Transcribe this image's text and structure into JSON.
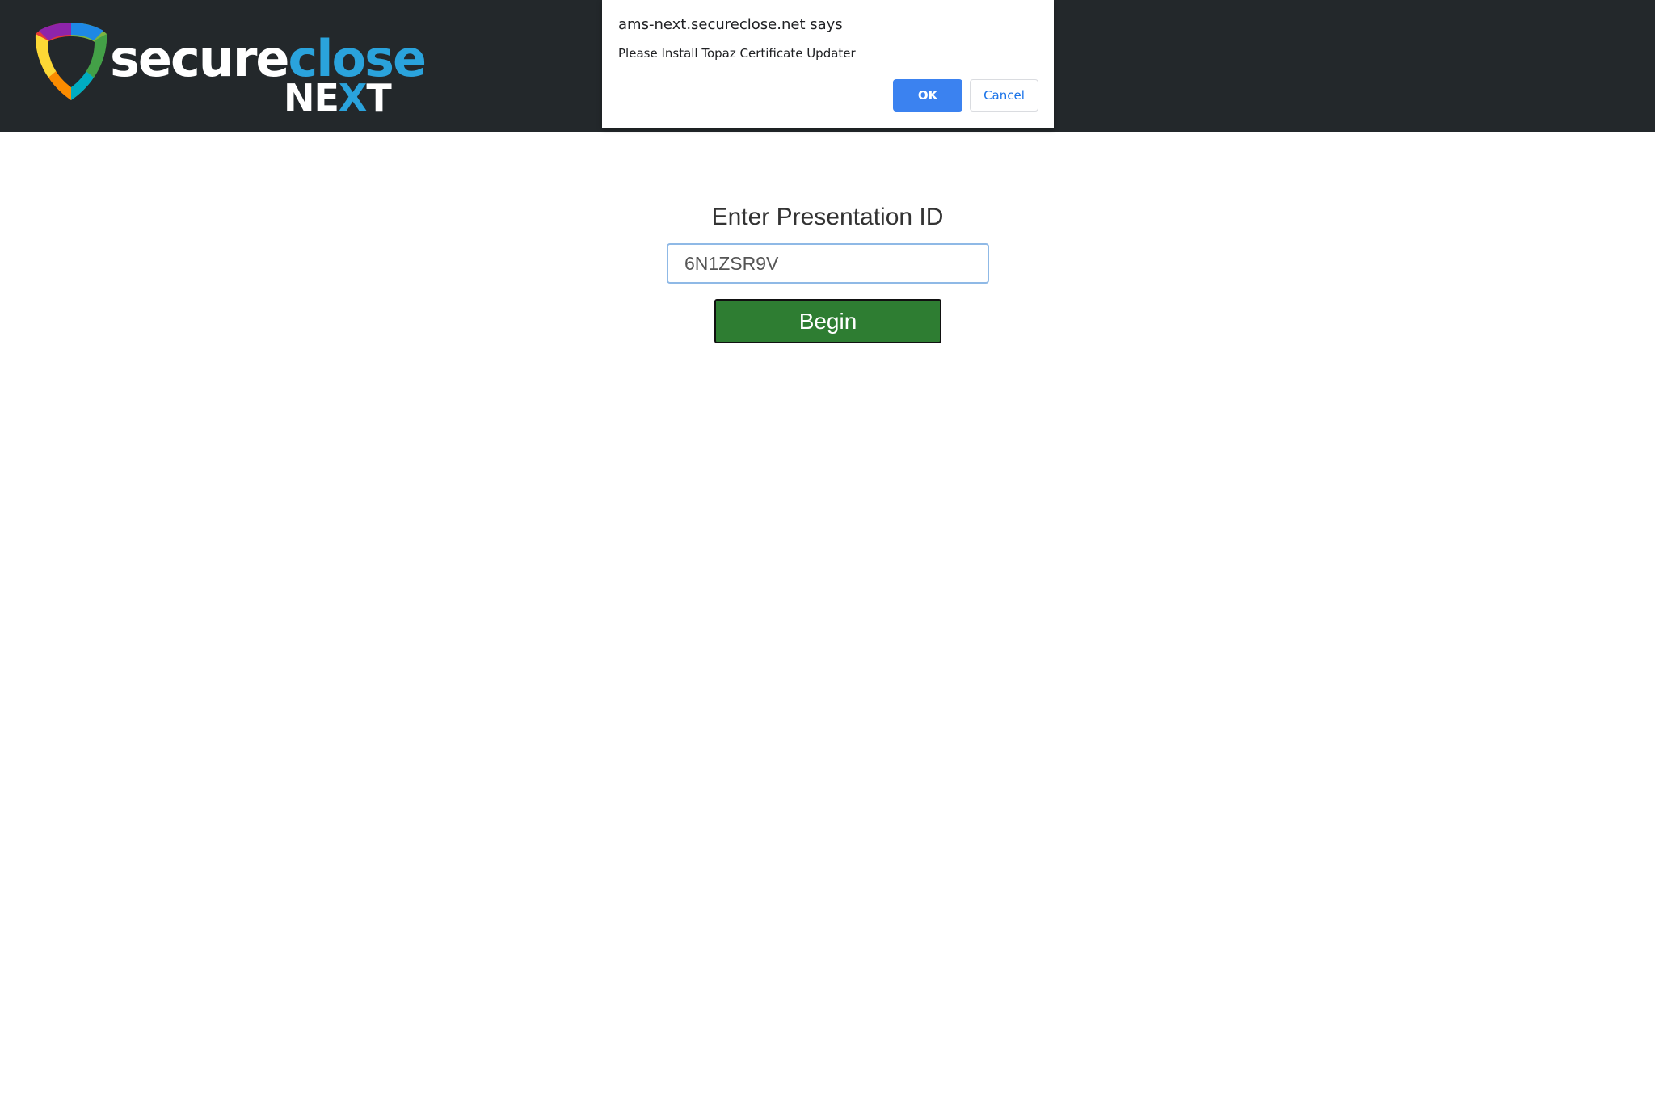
{
  "header": {
    "logo": {
      "icon": "shield-logo-icon",
      "word_secure": "secure",
      "word_close": "close",
      "word_next_1": "NE",
      "word_next_2": "X",
      "word_next_3": "T"
    }
  },
  "dialog": {
    "title": "ams-next.secureclose.net says",
    "message": "Please Install Topaz Certificate Updater",
    "ok_label": "OK",
    "cancel_label": "Cancel"
  },
  "form": {
    "heading": "Enter Presentation ID",
    "presentation_id_value": "6N1ZSR9V",
    "begin_label": "Begin"
  },
  "colors": {
    "header_bg": "#23282b",
    "brand_blue": "#2aa3dc",
    "begin_green": "#2e7d32",
    "ok_blue": "#3b82f0"
  }
}
